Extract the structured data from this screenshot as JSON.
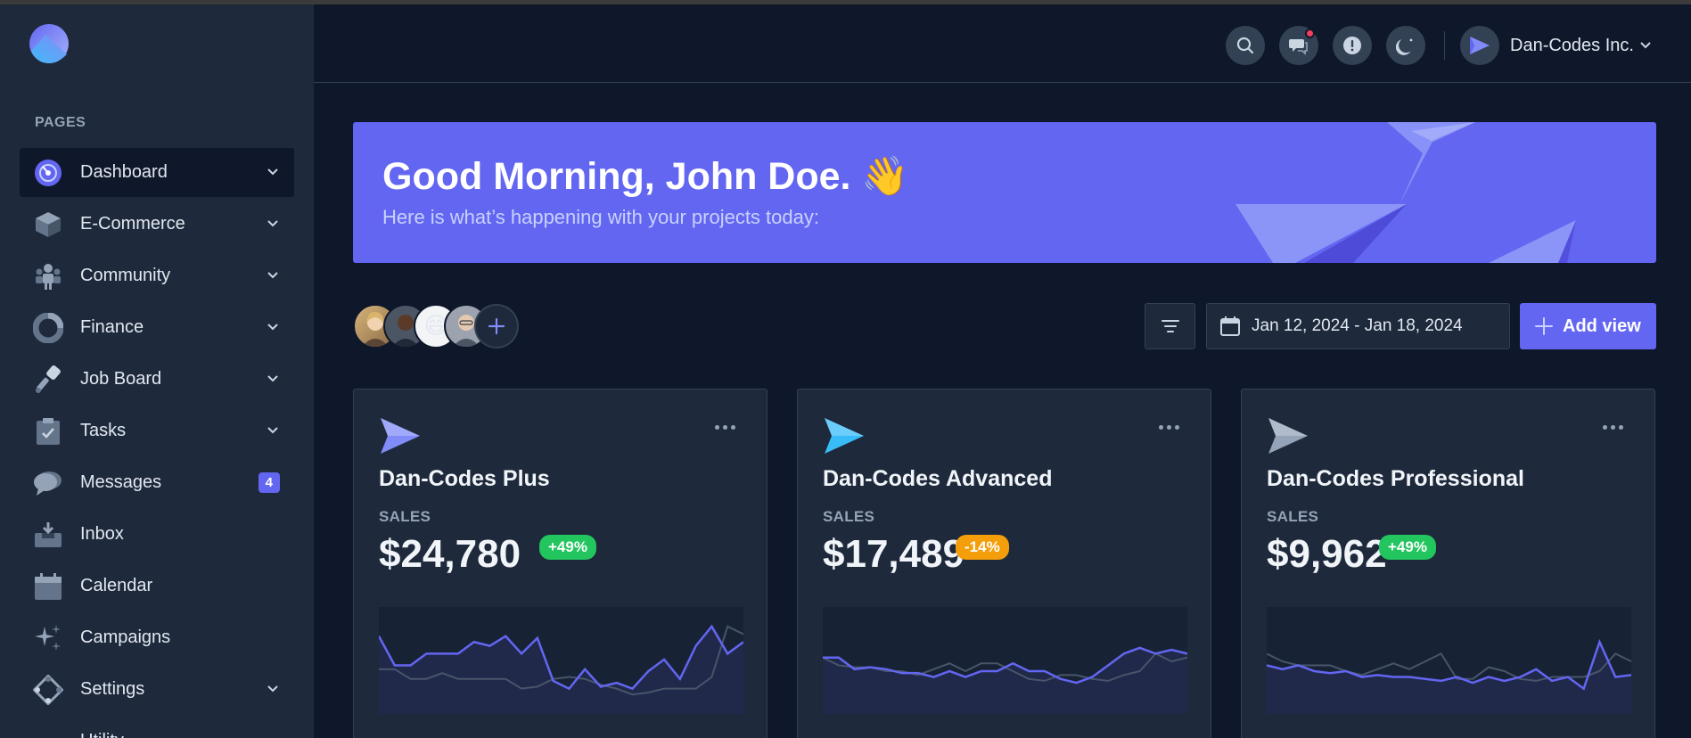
{
  "sidebar": {
    "section_label": "PAGES",
    "items": [
      {
        "label": "Dashboard",
        "icon": "dashboard-icon",
        "chevron": true,
        "active": true
      },
      {
        "label": "E-Commerce",
        "icon": "cube-icon",
        "chevron": true
      },
      {
        "label": "Community",
        "icon": "people-icon",
        "chevron": true
      },
      {
        "label": "Finance",
        "icon": "pie-icon",
        "chevron": true
      },
      {
        "label": "Job Board",
        "icon": "tools-icon",
        "chevron": true
      },
      {
        "label": "Tasks",
        "icon": "clipboard-icon",
        "chevron": true
      },
      {
        "label": "Messages",
        "icon": "chat-icon",
        "badge": "4"
      },
      {
        "label": "Inbox",
        "icon": "inbox-icon"
      },
      {
        "label": "Calendar",
        "icon": "calendar-icon"
      },
      {
        "label": "Campaigns",
        "icon": "sparkles-icon"
      },
      {
        "label": "Settings",
        "icon": "settings-icon",
        "chevron": true
      },
      {
        "label": "Utility",
        "icon": "utility-icon"
      }
    ]
  },
  "header": {
    "account_name": "Dan-Codes Inc."
  },
  "banner": {
    "title": "Good Morning, John Doe. 👋",
    "subtitle": "Here is what’s happening with your projects today:"
  },
  "toolbar": {
    "avatar_emoji": "😄",
    "date_range": "Jan 12, 2024 - Jan 18, 2024",
    "add_view_label": "Add view"
  },
  "cards": [
    {
      "title": "Dan-Codes Plus",
      "label": "SALES",
      "value": "$24,780",
      "change": "+49%",
      "trend": "up",
      "icon_color": "#818cf8",
      "series_main": [
        650,
        500,
        500,
        560,
        560,
        560,
        620,
        600,
        650,
        560,
        640,
        420,
        380,
        480,
        390,
        410,
        380,
        470,
        530,
        430,
        600,
        700,
        560,
        620
      ],
      "series_prev": [
        480,
        480,
        430,
        430,
        460,
        430,
        430,
        430,
        430,
        380,
        390,
        430,
        440,
        430,
        400,
        380,
        350,
        360,
        380,
        380,
        380,
        440,
        700,
        660
      ]
    },
    {
      "title": "Dan-Codes Advanced",
      "label": "SALES",
      "value": "$17,489",
      "change": "-14%",
      "trend": "down",
      "icon_color": "#38bdf8",
      "series_main": [
        540,
        540,
        480,
        490,
        480,
        460,
        460,
        440,
        470,
        440,
        470,
        470,
        510,
        470,
        470,
        430,
        410,
        440,
        500,
        560,
        590,
        560,
        580,
        560
      ],
      "series_prev": [
        540,
        500,
        490,
        490,
        470,
        470,
        450,
        480,
        510,
        470,
        510,
        510,
        470,
        430,
        420,
        450,
        450,
        430,
        420,
        450,
        470,
        560,
        520,
        540
      ]
    },
    {
      "title": "Dan-Codes Professional",
      "label": "SALES",
      "value": "$9,962",
      "change": "+49%",
      "trend": "up",
      "icon_color": "#94a3b8",
      "series_main": [
        500,
        480,
        500,
        470,
        460,
        470,
        440,
        450,
        440,
        440,
        430,
        420,
        440,
        410,
        440,
        420,
        440,
        480,
        420,
        440,
        380,
        620,
        440,
        450
      ],
      "series_prev": [
        560,
        520,
        500,
        500,
        500,
        470,
        450,
        480,
        510,
        480,
        520,
        560,
        430,
        430,
        490,
        470,
        430,
        420,
        440,
        440,
        440,
        470,
        560,
        520
      ]
    }
  ],
  "colors": {
    "accent": "#6366f1",
    "sidebar_bg": "#1e293b",
    "page_bg": "#0f172a",
    "positive": "#22c55e",
    "negative": "#f59e0b"
  }
}
